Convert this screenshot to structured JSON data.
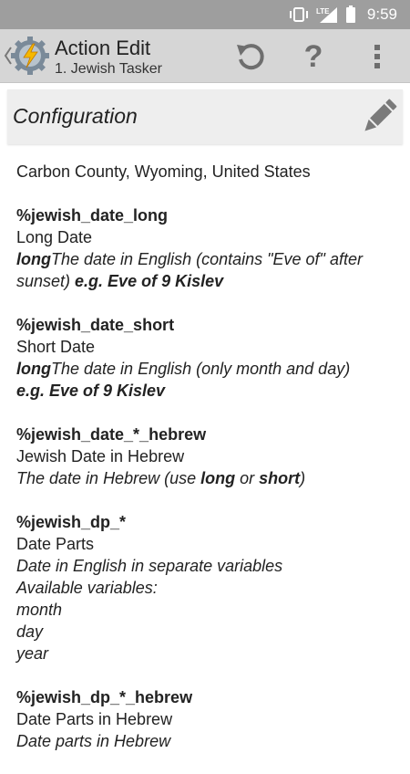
{
  "status": {
    "time": "9:59",
    "network": "LTE"
  },
  "actionbar": {
    "title": "Action Edit",
    "subtitle": "1. Jewish Tasker"
  },
  "config": {
    "title": "Configuration"
  },
  "location": "Carbon County, Wyoming, United States",
  "sections": [
    {
      "var": "%jewish_date_long",
      "name": "Long Date",
      "desc_bold": "long",
      "desc_rest": "The date in English (contains \"Eve of\" after sunset)",
      "example": "e.g. Eve of 9 Kislev"
    },
    {
      "var": "%jewish_date_short",
      "name": "Short Date",
      "desc_bold": "long",
      "desc_rest": "The date in English (only month and day)",
      "example": "e.g. Eve of 9 Kislev"
    },
    {
      "var": "%jewish_date_*_hebrew",
      "name": "Jewish Date in Hebrew",
      "desc_pre": "The date in Hebrew (use ",
      "desc_b1": "long",
      "desc_mid": " or ",
      "desc_b2": "short",
      "desc_post": ")"
    },
    {
      "var": "%jewish_dp_*",
      "name": "Date Parts",
      "lines": [
        "Date in English in separate variables",
        "Available variables:",
        "month",
        "day",
        "year"
      ]
    },
    {
      "var": "%jewish_dp_*_hebrew",
      "name": "Date Parts in Hebrew",
      "partial": "Date parts in Hebrew"
    }
  ]
}
